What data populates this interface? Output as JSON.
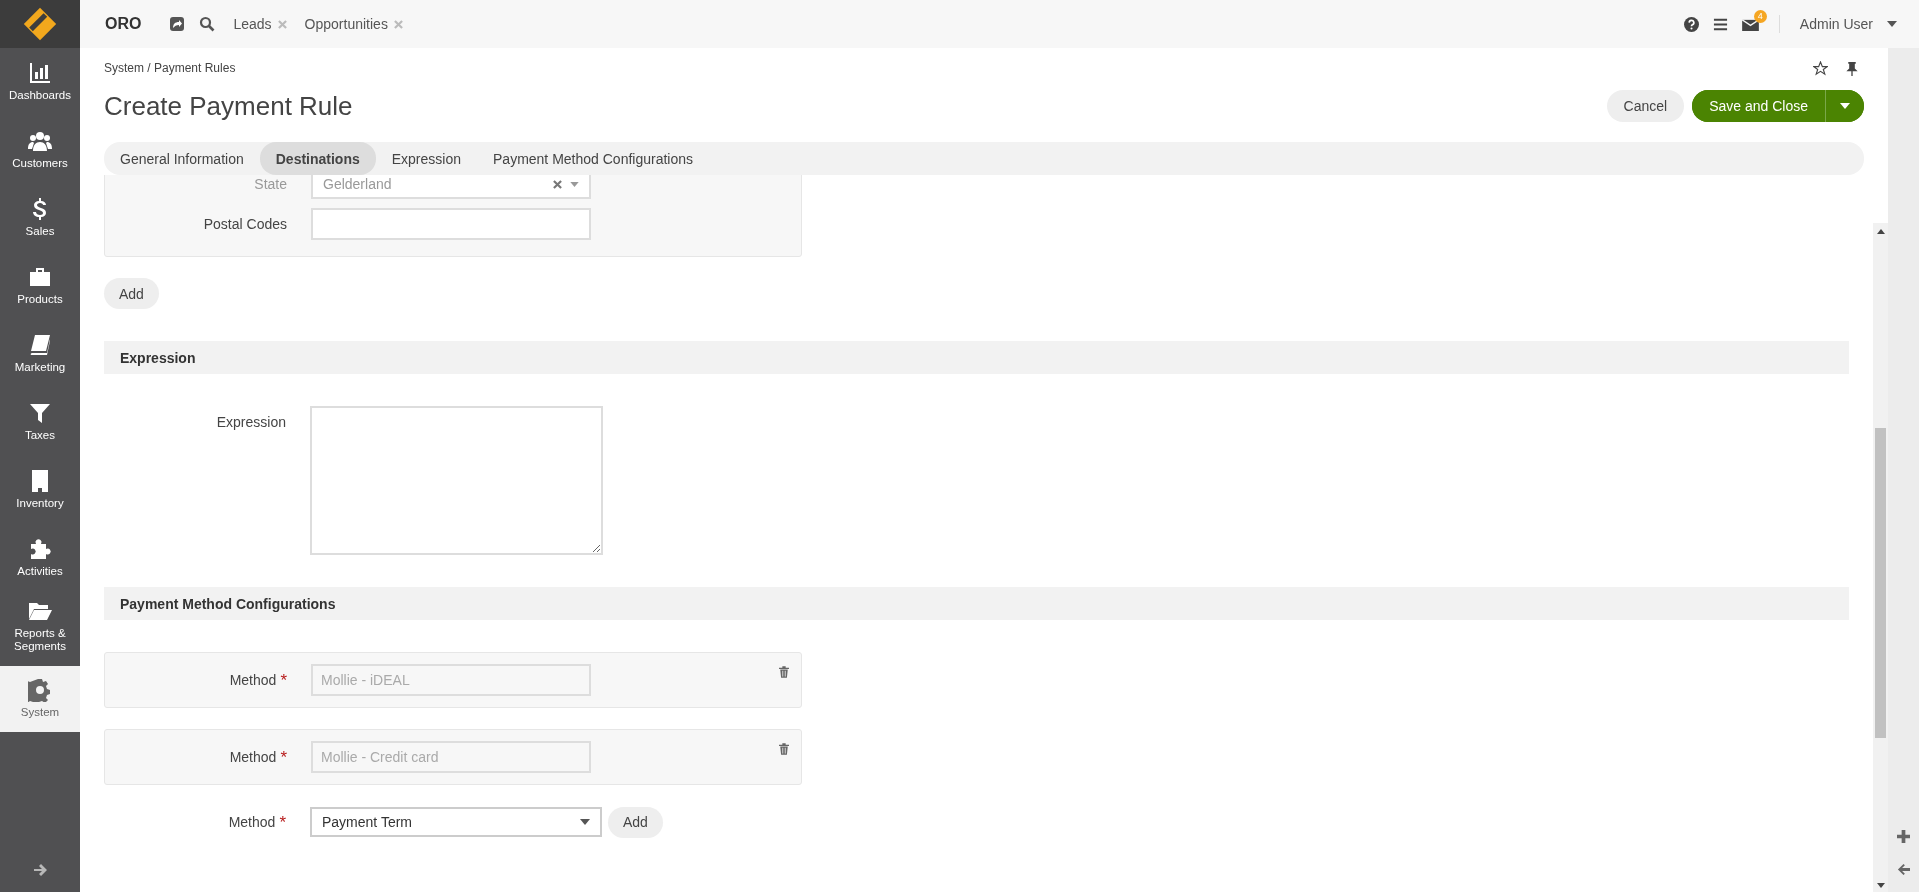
{
  "sidebar": {
    "items": [
      {
        "label": "Dashboards",
        "selected": false
      },
      {
        "label": "Customers",
        "selected": false
      },
      {
        "label": "Sales",
        "selected": false
      },
      {
        "label": "Products",
        "selected": false
      },
      {
        "label": "Marketing",
        "selected": false
      },
      {
        "label": "Taxes",
        "selected": false
      },
      {
        "label": "Inventory",
        "selected": false
      },
      {
        "label": "Activities",
        "selected": false
      },
      {
        "label": "Reports & Segments",
        "selected": false
      },
      {
        "label": "System",
        "selected": true
      }
    ]
  },
  "top_bar": {
    "brand": "ORO",
    "pinned_tabs": [
      "Leads",
      "Opportunities"
    ],
    "notifications_badge": "4",
    "user": "Admin User"
  },
  "breadcrumb": "System / Payment Rules",
  "page_title": "Create Payment Rule",
  "actions": {
    "cancel": "Cancel",
    "save": "Save and Close"
  },
  "tabs": [
    {
      "label": "General Information",
      "selected": false
    },
    {
      "label": "Destinations",
      "selected": true
    },
    {
      "label": "Expression",
      "selected": false
    },
    {
      "label": "Payment Method Configurations",
      "selected": false
    }
  ],
  "destination": {
    "state_label": "State",
    "state_value": "Gelderland",
    "postal_codes_label": "Postal Codes",
    "add_button": "Add"
  },
  "expression_section": {
    "title": "Expression",
    "field_label": "Expression"
  },
  "payment_methods_section": {
    "title": "Payment Method Configurations",
    "configured": [
      {
        "label": "Method",
        "required_mark": "*",
        "value": "Mollie - iDEAL"
      },
      {
        "label": "Method",
        "required_mark": "*",
        "value": "Mollie - Credit card"
      }
    ],
    "new_method": {
      "label": "Method",
      "required_mark": "*",
      "value": "Payment Term",
      "add_button": "Add"
    }
  }
}
